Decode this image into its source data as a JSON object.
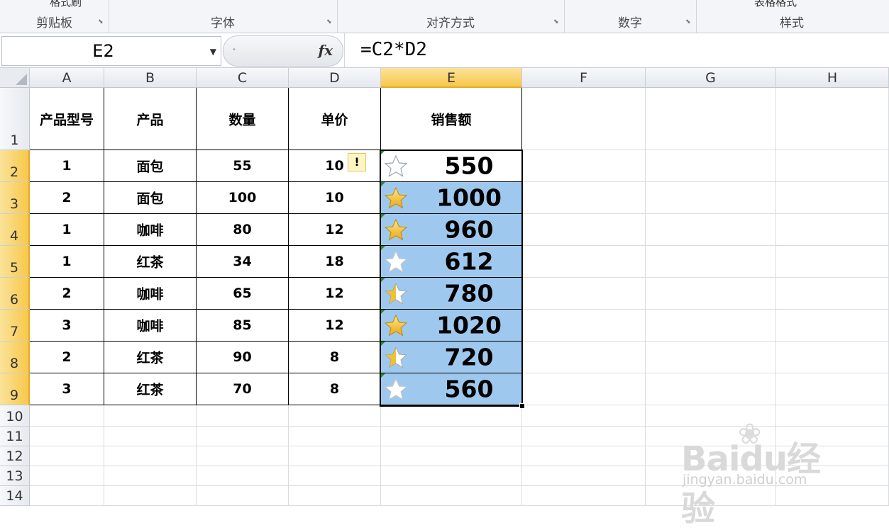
{
  "ribbon": {
    "groups": [
      {
        "label": "剪贴板",
        "top": "格式刷"
      },
      {
        "label": "字体"
      },
      {
        "label": "对齐方式"
      },
      {
        "label": "数字"
      },
      {
        "label": "样式",
        "top": "表格格式"
      }
    ]
  },
  "formula_bar": {
    "name_box": "E2",
    "fx": "fx",
    "formula": "=C2*D2"
  },
  "columns": [
    "A",
    "B",
    "C",
    "D",
    "E",
    "F",
    "G",
    "H"
  ],
  "rows": [
    "1",
    "2",
    "3",
    "4",
    "5",
    "6",
    "7",
    "8",
    "9",
    "10",
    "11",
    "12",
    "13",
    "14"
  ],
  "active_cell": "E2",
  "table": {
    "headers": [
      "产品型号",
      "产品",
      "数量",
      "单价",
      "销售额"
    ],
    "rows": [
      [
        "1",
        "面包",
        "55",
        "10",
        "550"
      ],
      [
        "2",
        "面包",
        "100",
        "10",
        "1000"
      ],
      [
        "1",
        "咖啡",
        "80",
        "12",
        "960"
      ],
      [
        "1",
        "红茶",
        "34",
        "18",
        "612"
      ],
      [
        "2",
        "咖啡",
        "65",
        "12",
        "780"
      ],
      [
        "3",
        "咖啡",
        "85",
        "12",
        "1020"
      ],
      [
        "2",
        "红茶",
        "90",
        "8",
        "720"
      ],
      [
        "3",
        "红茶",
        "70",
        "8",
        "560"
      ]
    ],
    "star_ratings": [
      "empty-outline",
      "full",
      "full",
      "empty",
      "half",
      "full",
      "half",
      "empty"
    ]
  },
  "colors": {
    "selection_fill": "#9fc8ee",
    "active_header": "#f7c84a",
    "star_gold": "#f2c12e"
  },
  "watermark": {
    "brand": "Baidu经验",
    "url": "jingyan.baidu.com"
  }
}
